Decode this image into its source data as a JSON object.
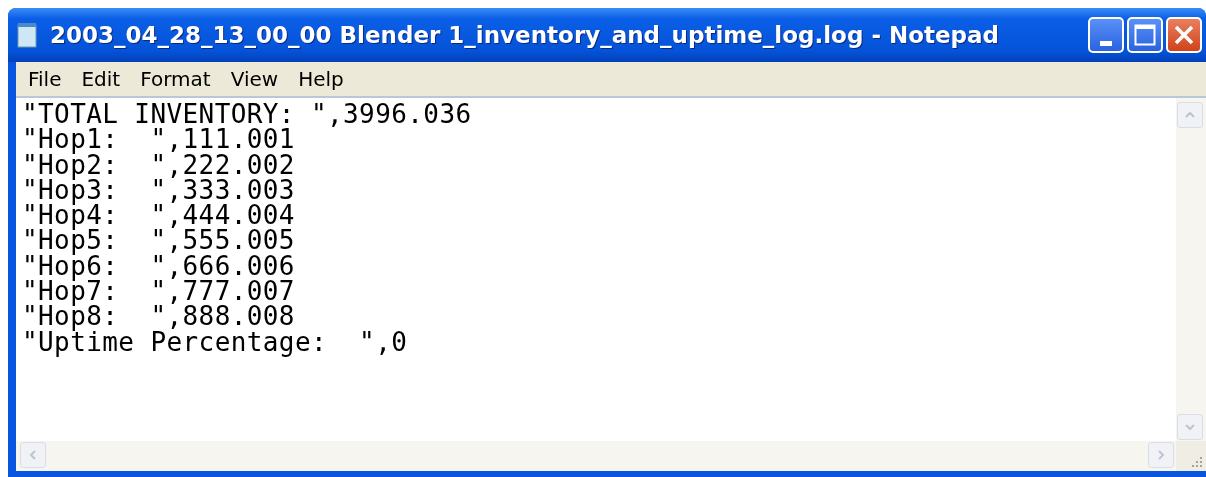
{
  "window": {
    "title": "2003_04_28_13_00_00 Blender 1_inventory_and_uptime_log.log - Notepad"
  },
  "menu": [
    "File",
    "Edit",
    "Format",
    "View",
    "Help"
  ],
  "document": {
    "lines": [
      "\"TOTAL INVENTORY: \",3996.036",
      "\"Hop1:  \",111.001",
      "\"Hop2:  \",222.002",
      "\"Hop3:  \",333.003",
      "\"Hop4:  \",444.004",
      "\"Hop5:  \",555.005",
      "\"Hop6:  \",666.006",
      "\"Hop7:  \",777.007",
      "\"Hop8:  \",888.008",
      "\"Uptime Percentage:  \",0"
    ]
  }
}
